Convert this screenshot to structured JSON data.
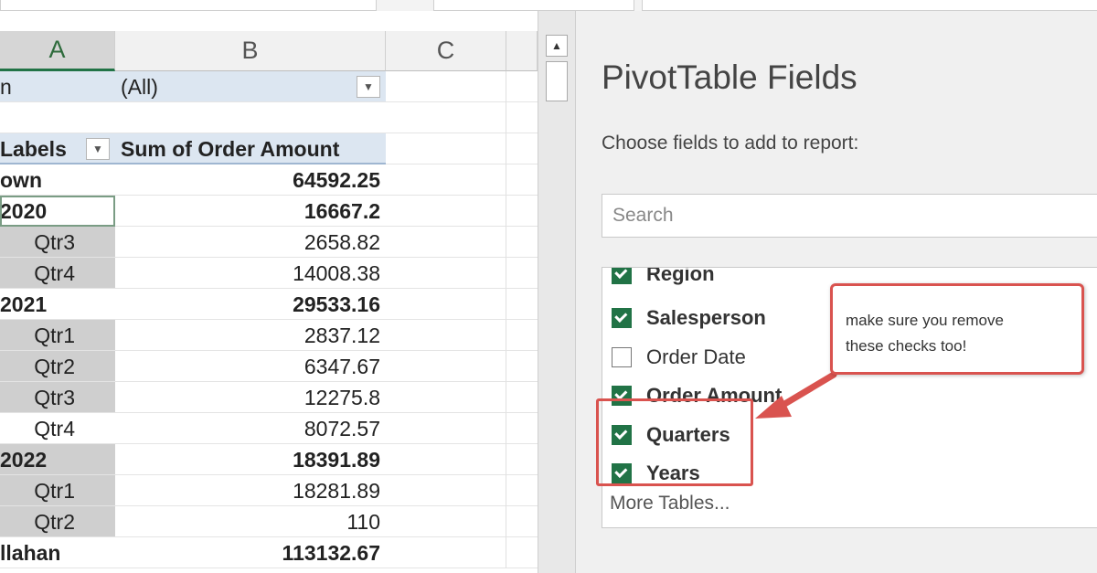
{
  "sheet": {
    "columns": [
      {
        "letter": "A",
        "selected": true
      },
      {
        "letter": "B",
        "selected": false
      },
      {
        "letter": "C",
        "selected": false
      }
    ],
    "filter": {
      "label": "n",
      "value": "(All)"
    },
    "header": {
      "row_labels": "Labels",
      "value_label": "Sum of Order Amount"
    },
    "rows": [
      {
        "label": "own",
        "value": "64592.25",
        "bold": true,
        "shade": false,
        "indent": 0
      },
      {
        "label": "2020",
        "value": "16667.2",
        "bold": true,
        "shade": false,
        "indent": 1,
        "selected": true
      },
      {
        "label": "Qtr3",
        "value": "2658.82",
        "bold": false,
        "shade": true,
        "indent": 2
      },
      {
        "label": "Qtr4",
        "value": "14008.38",
        "bold": false,
        "shade": true,
        "indent": 2
      },
      {
        "label": "2021",
        "value": "29533.16",
        "bold": true,
        "shade": false,
        "indent": 1
      },
      {
        "label": "Qtr1",
        "value": "2837.12",
        "bold": false,
        "shade": true,
        "indent": 2
      },
      {
        "label": "Qtr2",
        "value": "6347.67",
        "bold": false,
        "shade": true,
        "indent": 2
      },
      {
        "label": "Qtr3",
        "value": "12275.8",
        "bold": false,
        "shade": true,
        "indent": 2
      },
      {
        "label": "Qtr4",
        "value": "8072.57",
        "bold": false,
        "shade": false,
        "indent": 2
      },
      {
        "label": "2022",
        "value": "18391.89",
        "bold": true,
        "shade": true,
        "indent": 1
      },
      {
        "label": "Qtr1",
        "value": "18281.89",
        "bold": false,
        "shade": true,
        "indent": 2
      },
      {
        "label": "Qtr2",
        "value": "110",
        "bold": false,
        "shade": true,
        "indent": 2
      },
      {
        "label": "llahan",
        "value": "113132.67",
        "bold": true,
        "shade": false,
        "indent": 0
      }
    ]
  },
  "pane": {
    "title": "PivotTable Fields",
    "subtitle": "Choose fields to add to report:",
    "search_placeholder": "Search",
    "fields": [
      {
        "label": "Region",
        "checked": true,
        "bold": true
      },
      {
        "label": "Salesperson",
        "checked": true,
        "bold": true
      },
      {
        "label": "Order Date",
        "checked": false,
        "bold": false
      },
      {
        "label": "Order Amount",
        "checked": true,
        "bold": true
      },
      {
        "label": "Quarters",
        "checked": true,
        "bold": true
      },
      {
        "label": "Years",
        "checked": true,
        "bold": true
      }
    ],
    "more_tables": "More Tables..."
  },
  "annotation": {
    "text_line1": "make sure you remove",
    "text_line2": "these checks too!",
    "color": "#d9534f"
  },
  "colors": {
    "excel_green": "#217346",
    "header_blue": "#dce6f1",
    "shade_gray": "#cfcfcf"
  }
}
